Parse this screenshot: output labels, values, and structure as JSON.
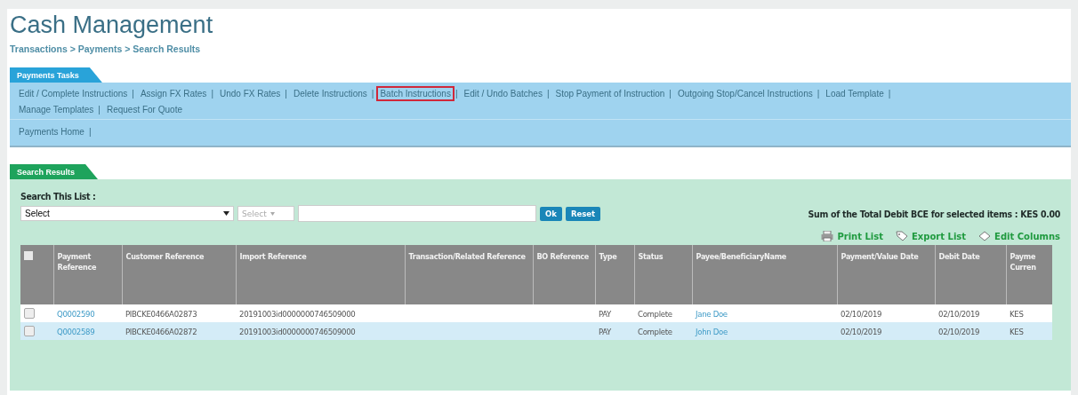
{
  "header": {
    "title": "Cash Management",
    "breadcrumb": "Transactions > Payments > Search Results"
  },
  "tasks": {
    "tab": "Payments Tasks",
    "links": [
      {
        "label": "Edit / Complete Instructions",
        "sep": "|",
        "highlighted": false
      },
      {
        "label": "Assign FX Rates",
        "sep": "|",
        "highlighted": false
      },
      {
        "label": "Undo FX Rates",
        "sep": "|",
        "highlighted": false
      },
      {
        "label": "Delete Instructions",
        "sep": "|",
        "highlighted": false
      },
      {
        "label": "Batch Instructions",
        "sep": "|",
        "highlighted": true
      },
      {
        "label": "Edit / Undo Batches",
        "sep": "|",
        "highlighted": false
      },
      {
        "label": "Stop Payment of Instruction",
        "sep": "|",
        "highlighted": false
      },
      {
        "label": "Outgoing Stop/Cancel Instructions",
        "sep": "|",
        "highlighted": false
      },
      {
        "label": "Load Template",
        "sep": "|",
        "highlighted": false
      },
      {
        "label": "Manage Templates",
        "sep": "|",
        "highlighted": false
      },
      {
        "label": "Request For Quote",
        "highlighted": false
      }
    ],
    "home_links": [
      {
        "label": "Payments Home",
        "sep": "|"
      }
    ]
  },
  "results": {
    "tab": "Search Results",
    "search_label": "Search This List :",
    "field_select": "Select",
    "operator_select": "Select",
    "ok_button": "Ok",
    "reset_button": "Reset",
    "sum_text": "Sum of the Total Debit BCE for selected items : KES 0.00",
    "actions": [
      {
        "kind": "print",
        "label": "Print List"
      },
      {
        "kind": "export",
        "label": "Export List"
      },
      {
        "kind": "edit",
        "label": "Edit Columns"
      }
    ],
    "table": {
      "select_all_checked": false,
      "columns": [
        "Payment Reference",
        "Customer Reference",
        "Import Reference",
        "Transaction/Related Reference",
        "BO Reference",
        "Type",
        "Status",
        "Payee/BeneficiaryName",
        "Payment/Value Date",
        "Debit Date",
        "Payme Curren"
      ],
      "rows": [
        {
          "checked": false,
          "highlighted": false,
          "cells": [
            "Q0002590",
            "PIBCKE0466A02873",
            "20191003id0000000746509000",
            "",
            "",
            "PAY",
            "Complete",
            "Jane Doe",
            "02/10/2019",
            "02/10/2019",
            "KES"
          ]
        },
        {
          "checked": false,
          "highlighted": true,
          "cells": [
            "Q0002589",
            "PIBCKE0466A02872",
            "20191003id0000000746509000",
            "",
            "",
            "PAY",
            "Complete",
            "John Doe",
            "02/10/2019",
            "02/10/2019",
            "KES"
          ]
        }
      ]
    }
  }
}
